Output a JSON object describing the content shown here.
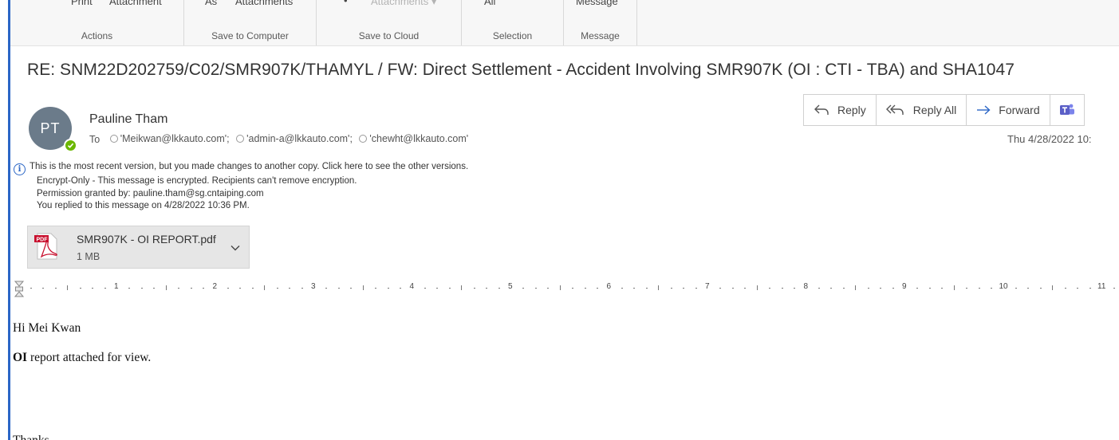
{
  "ribbon": {
    "groups": [
      {
        "buttons": [
          "Print",
          "Attachment"
        ],
        "caption": "Actions"
      },
      {
        "buttons": [
          "As",
          "Attachments"
        ],
        "caption": "Save to Computer"
      },
      {
        "buttons": [
          "Attachments"
        ],
        "caption": "Save to Cloud"
      },
      {
        "buttons": [
          "All"
        ],
        "caption": "Selection"
      },
      {
        "buttons": [
          "Message"
        ],
        "caption": "Message"
      }
    ]
  },
  "email": {
    "subject": "RE: SNM22D202759/C02/SMR907K/THAMYL / FW: Direct Settlement - Accident Involving SMR907K (OI : CTI - TBA) and SHA1047",
    "sender": {
      "name": "Pauline Tham",
      "initials": "PT",
      "avatar_color": "#6b7b8a",
      "presence_color": "#6bb700"
    },
    "to_label": "To",
    "recipients": [
      "'Meikwan@lkkauto.com';",
      "'admin-a@lkkauto.com';",
      "'chewht@lkkauto.com'"
    ],
    "date": "Thu 4/28/2022 10:",
    "actions": {
      "reply": "Reply",
      "reply_all": "Reply All",
      "forward": "Forward"
    },
    "info": {
      "version_notice": "This is the most recent version, but you made changes to another copy. Click here to see the other versions.",
      "encryption": "Encrypt-Only - This message is encrypted. Recipients can't remove encryption.",
      "permission": "Permission granted by: pauline.tham@sg.cntaiping.com",
      "replied": "You replied to this message on 4/28/2022 10:36 PM."
    },
    "attachment": {
      "name": "SMR907K - OI REPORT.pdf",
      "size": "1 MB",
      "icon": "pdf-icon"
    },
    "ruler": {
      "numbers": [
        "1",
        "2",
        "3",
        "4",
        "5",
        "6",
        "7",
        "8",
        "9",
        "10",
        "11"
      ]
    },
    "body": {
      "greeting": "Hi Mei Kwan",
      "line1_bold": "OI",
      "line1_rest": " report attached for view.",
      "closing": "Thanks"
    }
  },
  "colors": {
    "accent": "#2b66c6",
    "teams": "#5b5fc7"
  }
}
